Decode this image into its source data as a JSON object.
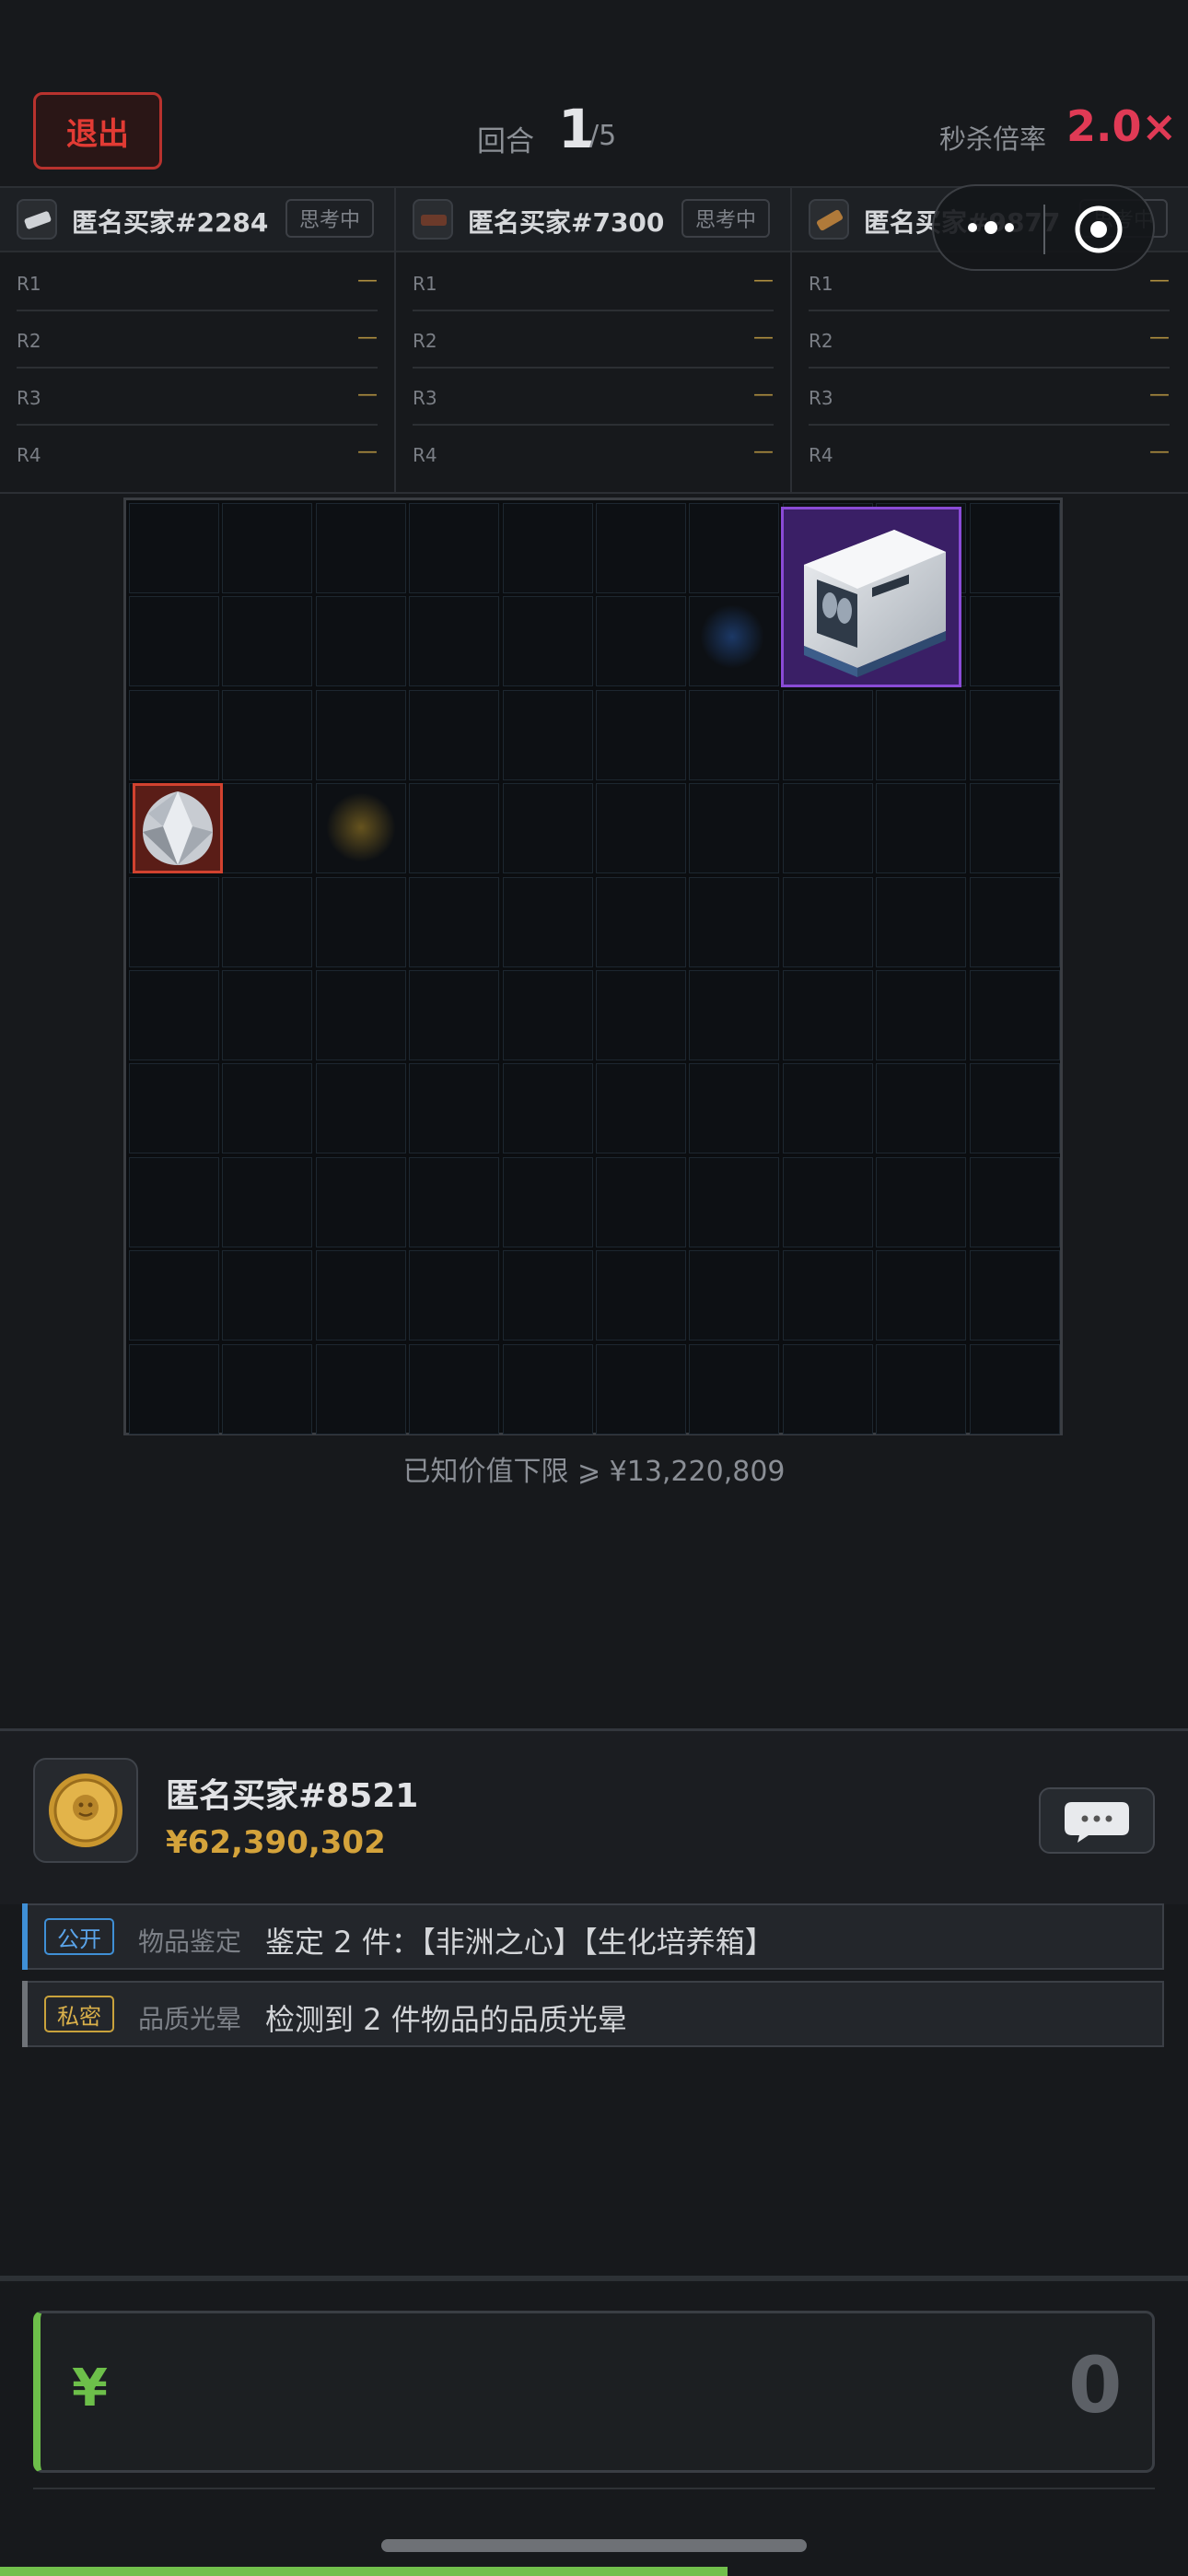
{
  "header": {
    "exit_label": "退出",
    "round_label": "回合",
    "round_current": "1",
    "round_total": "/5",
    "multiplier_label": "秒杀倍率",
    "multiplier_value": "2.0×"
  },
  "buyers": [
    {
      "name": "匿名买家#2284",
      "status": "思考中",
      "icon_color": "#cfd2d6",
      "rounds": [
        {
          "label": "R1",
          "value": "—"
        },
        {
          "label": "R2",
          "value": "—"
        },
        {
          "label": "R3",
          "value": "—"
        },
        {
          "label": "R4",
          "value": "—"
        }
      ]
    },
    {
      "name": "匿名买家#7300",
      "status": "思考中",
      "icon_color": "#6b3a2a",
      "rounds": [
        {
          "label": "R1",
          "value": "—"
        },
        {
          "label": "R2",
          "value": "—"
        },
        {
          "label": "R3",
          "value": "—"
        },
        {
          "label": "R4",
          "value": "—"
        }
      ]
    },
    {
      "name": "匿名买家#9877",
      "status": "思考中",
      "icon_color": "#b07a3a",
      "rounds": [
        {
          "label": "R1",
          "value": "—"
        },
        {
          "label": "R2",
          "value": "—"
        },
        {
          "label": "R3",
          "value": "—"
        },
        {
          "label": "R4",
          "value": "—"
        }
      ]
    }
  ],
  "board": {
    "floor_label": "已知价值下限 ⩾ ¥13,220,809",
    "items": [
      {
        "name": "生化培养箱",
        "rarity_color": "#8a4bd6"
      },
      {
        "name": "非洲之心",
        "rarity_color": "#d2422f"
      }
    ]
  },
  "player": {
    "name": "匿名买家#8521",
    "money": "¥62,390,302"
  },
  "logs": [
    {
      "tag": "公开",
      "type": "物品鉴定",
      "text": "鉴定 2 件：【非洲之心】【生化培养箱】",
      "color": "#3f8fd6"
    },
    {
      "tag": "私密",
      "type": "品质光晕",
      "text": "检测到 2 件物品的品质光晕",
      "color": "#c9a23c"
    }
  ],
  "bid": {
    "currency": "¥",
    "value": "0"
  }
}
